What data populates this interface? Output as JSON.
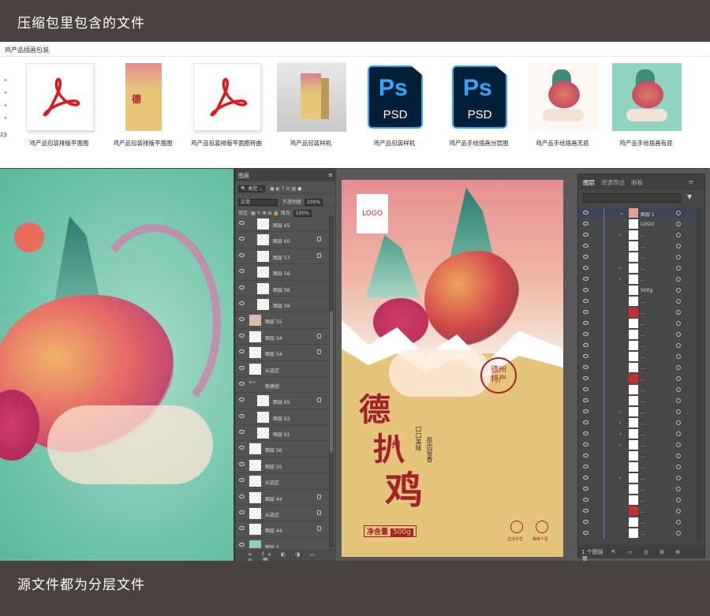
{
  "header": {
    "title": "压缩包里包含的文件"
  },
  "footer": {
    "title": "源文件都为分层文件"
  },
  "explorer": {
    "path": "鸡产品插画包装",
    "side_number": "23",
    "files": [
      {
        "label": "鸡产品包装排版平面图",
        "type": "pdf-icon"
      },
      {
        "label": "鸡产品包装排版平面图",
        "type": "package-preview"
      },
      {
        "label": "鸡产品包装排版平面图转曲",
        "type": "pdf-icon"
      },
      {
        "label": "鸡产品包装样机",
        "type": "box-mockup"
      },
      {
        "label": "鸡产品包装样机",
        "type": "psd-icon"
      },
      {
        "label": "鸡产品手绘插画分层图",
        "type": "psd-icon"
      },
      {
        "label": "鸡产品手绘插画无底",
        "type": "illustration"
      },
      {
        "label": "鸡产品手绘插画有底",
        "type": "illustration-teal"
      }
    ],
    "psd_icon": {
      "ps": "Ps",
      "ext": "PSD"
    }
  },
  "ps_panel": {
    "tab": "图层",
    "filter": "类型",
    "blend": "正常",
    "opacity_label": "不透明度:",
    "opacity": "100%",
    "lock_label": "锁定:",
    "fill_label": "填充:",
    "fill": "100%",
    "layers": [
      {
        "name": "图层 65",
        "indent": 1,
        "thumb": "tex",
        "lock": false
      },
      {
        "name": "图层 60",
        "indent": 1,
        "thumb": "tex",
        "lock": true
      },
      {
        "name": "图层 57",
        "indent": 1,
        "thumb": "tex",
        "lock": true
      },
      {
        "name": "图层 56",
        "indent": 1,
        "thumb": "tex",
        "lock": false
      },
      {
        "name": "图层 56",
        "indent": 1,
        "thumb": "tex",
        "lock": false
      },
      {
        "name": "图层 56",
        "indent": 1,
        "thumb": "tex",
        "lock": false
      },
      {
        "name": "图层 55",
        "indent": 0,
        "thumb": "art",
        "lock": false
      },
      {
        "name": "图层 54",
        "indent": 0,
        "thumb": "tex",
        "lock": true
      },
      {
        "name": "图层 54",
        "indent": 0,
        "thumb": "tex",
        "lock": true
      },
      {
        "name": "从选区",
        "indent": 0,
        "thumb": "tex",
        "lock": false
      },
      {
        "name": "新建组",
        "indent": 0,
        "thumb": "folder",
        "lock": false
      },
      {
        "name": "图层 65",
        "indent": 1,
        "thumb": "tex",
        "lock": true
      },
      {
        "name": "图层 63",
        "indent": 1,
        "thumb": "tex",
        "lock": false
      },
      {
        "name": "图层 61",
        "indent": 1,
        "thumb": "tex",
        "lock": false
      },
      {
        "name": "图层 56",
        "indent": 0,
        "thumb": "tex",
        "lock": false
      },
      {
        "name": "图层 55",
        "indent": 0,
        "thumb": "tex",
        "lock": false
      },
      {
        "name": "从选区",
        "indent": 0,
        "thumb": "tex",
        "lock": false
      },
      {
        "name": "图层 44",
        "indent": 0,
        "thumb": "tex",
        "lock": true
      },
      {
        "name": "从选区",
        "indent": 0,
        "thumb": "tex",
        "lock": true
      },
      {
        "name": "图层 44",
        "indent": 0,
        "thumb": "tex",
        "lock": true
      },
      {
        "name": "图层 5",
        "indent": 0,
        "thumb": "teal",
        "lock": false
      }
    ],
    "footer_icons": "∞ fx ◐ ◑ ▭ ⊞ 🗑"
  },
  "package": {
    "logo": "LOGO",
    "title_chars": [
      "德",
      "扒",
      "鸡"
    ],
    "small_title": "州",
    "tag1": "口口美味",
    "tag2": "唇齿留香",
    "stamp": "德州\n特产",
    "net_label": "净含量",
    "net_value": "500g",
    "icon1_label": "古法手艺",
    "icon2_label": "美味十足"
  },
  "ai_panel": {
    "tabs": [
      "图层",
      "资源导出",
      "画板"
    ],
    "active_tab": 0,
    "rows": [
      {
        "name": "图层 1",
        "arrow": "⌄",
        "sel": true,
        "thumb": "art"
      },
      {
        "name": "LOGO",
        "arrow": "",
        "thumb": "white"
      },
      {
        "name": "...",
        "arrow": "›",
        "thumb": "white"
      },
      {
        "name": "...",
        "arrow": "",
        "thumb": "white"
      },
      {
        "name": "...",
        "arrow": "",
        "thumb": "white"
      },
      {
        "name": "...",
        "arrow": "›",
        "thumb": "white"
      },
      {
        "name": "...",
        "arrow": "›",
        "thumb": "white"
      },
      {
        "name": "500g",
        "arrow": "",
        "thumb": "white"
      },
      {
        "name": "...",
        "arrow": "",
        "thumb": "white"
      },
      {
        "name": "...",
        "arrow": "",
        "thumb": "red"
      },
      {
        "name": "...",
        "arrow": "",
        "thumb": "white"
      },
      {
        "name": "...",
        "arrow": "",
        "thumb": "white"
      },
      {
        "name": "...",
        "arrow": "",
        "thumb": "white"
      },
      {
        "name": "...",
        "arrow": "",
        "thumb": "white"
      },
      {
        "name": "...",
        "arrow": "",
        "thumb": "white"
      },
      {
        "name": "...",
        "arrow": "",
        "thumb": "red"
      },
      {
        "name": "...",
        "arrow": "",
        "thumb": "white"
      },
      {
        "name": "...",
        "arrow": "",
        "thumb": "white"
      },
      {
        "name": "...",
        "arrow": "›",
        "thumb": "white"
      },
      {
        "name": "...",
        "arrow": "›",
        "thumb": "white"
      },
      {
        "name": "...",
        "arrow": "›",
        "thumb": "white"
      },
      {
        "name": "...",
        "arrow": "›",
        "thumb": "white"
      },
      {
        "name": "...",
        "arrow": "",
        "thumb": "white"
      },
      {
        "name": "...",
        "arrow": "",
        "thumb": "white"
      },
      {
        "name": "...",
        "arrow": "›",
        "thumb": "white"
      },
      {
        "name": "...",
        "arrow": "",
        "thumb": "white"
      },
      {
        "name": "...",
        "arrow": "",
        "thumb": "white"
      },
      {
        "name": "...",
        "arrow": "",
        "thumb": "red"
      },
      {
        "name": "...",
        "arrow": "",
        "thumb": "white"
      },
      {
        "name": "...",
        "arrow": "",
        "thumb": "white"
      }
    ],
    "footer": "1 个图层"
  }
}
